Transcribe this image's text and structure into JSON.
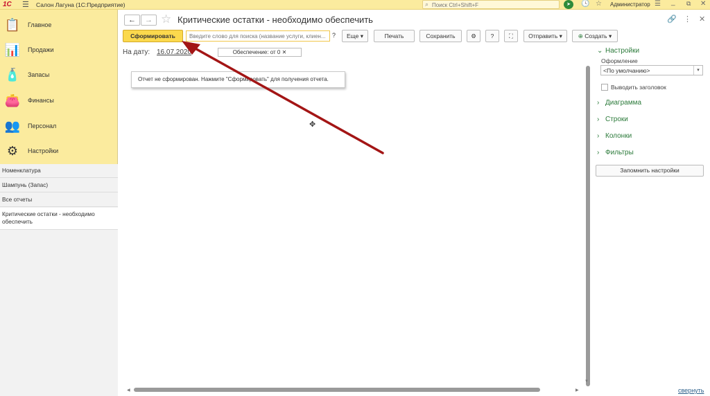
{
  "topbar": {
    "logo": "1С",
    "app_title": "Салон Лагуна  (1С:Предприятие)",
    "search_placeholder": "Поиск Ctrl+Shift+F",
    "user_name": "Администратор"
  },
  "sidebar": {
    "sections": [
      {
        "label": "Главное",
        "icon": "clipboard-icon",
        "glyph": "📋"
      },
      {
        "label": "Продажи",
        "icon": "chart-icon",
        "glyph": "📊"
      },
      {
        "label": "Запасы",
        "icon": "bottles-icon",
        "glyph": "🧴"
      },
      {
        "label": "Финансы",
        "icon": "wallet-icon",
        "glyph": "👛"
      },
      {
        "label": "Персонал",
        "icon": "people-icon",
        "glyph": "👥"
      },
      {
        "label": "Настройки",
        "icon": "gear-icon",
        "glyph": "⚙"
      }
    ],
    "open_windows": [
      {
        "label": "Номенклатура"
      },
      {
        "label": "Шампунь (Запас)"
      },
      {
        "label": "Все отчеты"
      },
      {
        "label": "Критические остатки - необходимо обеспечить"
      }
    ]
  },
  "header": {
    "title": "Критические остатки - необходимо обеспечить"
  },
  "toolbar": {
    "form_label": "Сформировать",
    "search_placeholder": "Введите слово для поиска (название услуги, клиен...",
    "help_mark": "?",
    "more_label": "Еще",
    "print_label": "Печать",
    "save_label": "Сохранить",
    "help_label": "?",
    "send_label": "Отправить",
    "create_label": "Создать"
  },
  "params": {
    "date_label": "На дату:",
    "date_value": "16.07.2020",
    "filter_chip": "Обеспечение: от 0"
  },
  "report": {
    "message": "Отчет не сформирован. Нажмите \"Сформировать\" для получения отчета."
  },
  "settings_panel": {
    "header": "Настройки",
    "format_label": "Оформление",
    "format_value": "<По умолчанию>",
    "show_title_label": "Выводить заголовок",
    "show_title_checked": false,
    "groups": [
      {
        "label": "Диаграмма"
      },
      {
        "label": "Строки"
      },
      {
        "label": "Колонки"
      },
      {
        "label": "Фильтры"
      }
    ],
    "save_button": "Запомнить настройки",
    "collapse_link": "свернуть"
  },
  "colors": {
    "sidebar_bg": "#fbeb9e",
    "primary_button": "#fbd94d",
    "panel_header": "#2b7a3a",
    "annotation_arrow": "#a31515"
  }
}
